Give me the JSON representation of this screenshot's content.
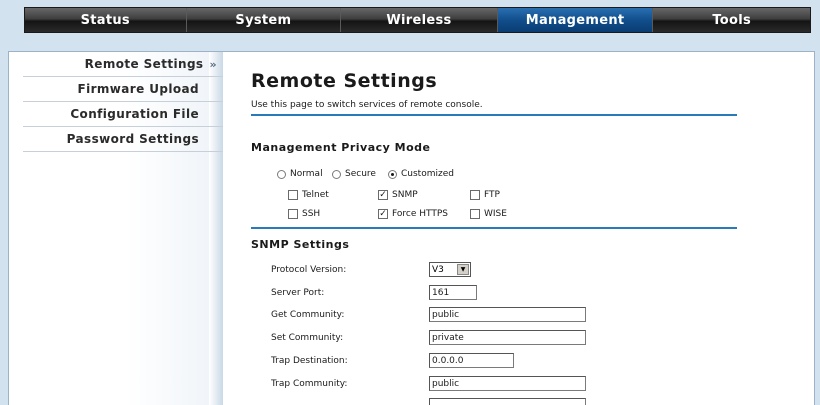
{
  "topnav": {
    "tabs": [
      {
        "label": "Status"
      },
      {
        "label": "System"
      },
      {
        "label": "Wireless"
      },
      {
        "label": "Management"
      },
      {
        "label": "Tools"
      }
    ]
  },
  "sidebar": {
    "items": [
      {
        "label": "Remote Settings"
      },
      {
        "label": "Firmware Upload"
      },
      {
        "label": "Configuration File"
      },
      {
        "label": "Password Settings"
      }
    ],
    "arrow": "»"
  },
  "page": {
    "title": "Remote Settings",
    "description": "Use this page to switch services of remote console."
  },
  "privacy": {
    "heading": "Management Privacy Mode",
    "modes": [
      {
        "label": "Normal",
        "selected": false
      },
      {
        "label": "Secure",
        "selected": false
      },
      {
        "label": "Customized",
        "selected": true
      }
    ],
    "services": [
      {
        "label": "Telnet",
        "checked": false
      },
      {
        "label": "SNMP",
        "checked": true
      },
      {
        "label": "FTP",
        "checked": false
      },
      {
        "label": "SSH",
        "checked": false
      },
      {
        "label": "Force HTTPS",
        "checked": true
      },
      {
        "label": "WISE",
        "checked": false
      }
    ]
  },
  "snmp": {
    "heading": "SNMP Settings",
    "fields": [
      {
        "label": "Protocol Version:",
        "value": "V3"
      },
      {
        "label": "Server Port:",
        "value": "161"
      },
      {
        "label": "Get Community:",
        "value": "public"
      },
      {
        "label": "Set Community:",
        "value": "private"
      },
      {
        "label": "Trap Destination:",
        "value": "0.0.0.0"
      },
      {
        "label": "Trap Community:",
        "value": "public"
      }
    ]
  },
  "colors": {
    "accent": "#2a7ab9",
    "active_tab": "#114e8c",
    "nav_bar": "#2a2a2a",
    "background": "#d3e2ef"
  }
}
